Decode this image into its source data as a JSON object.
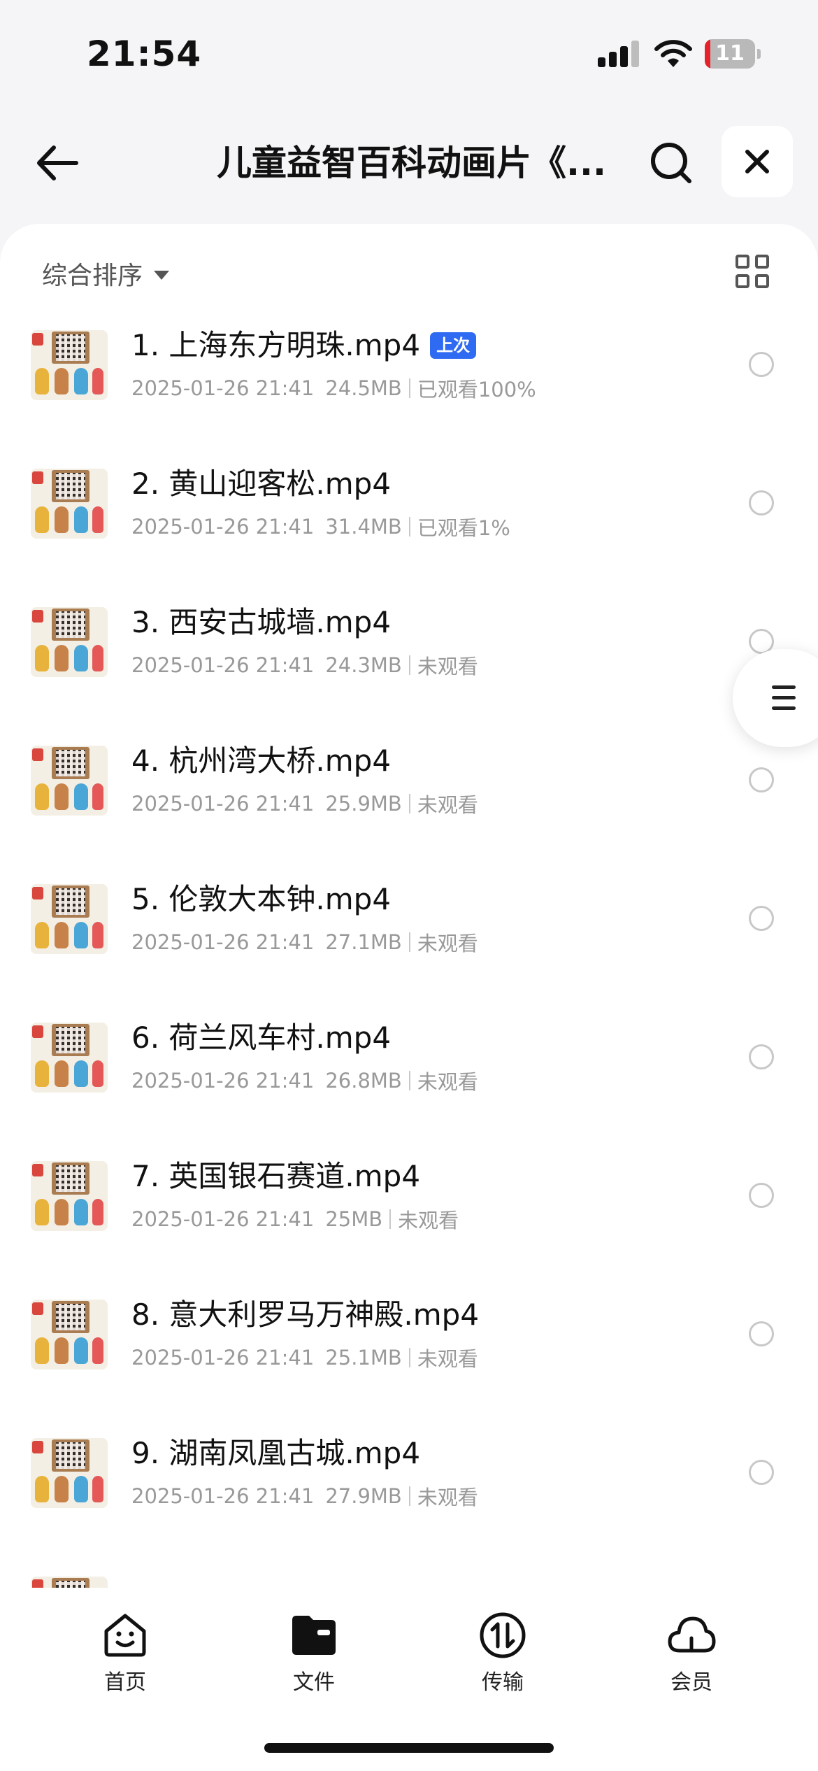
{
  "status_bar": {
    "time": "21:54",
    "battery_level": "11",
    "battery_fraction": 0.11,
    "battery_color": "#e8202a"
  },
  "nav": {
    "back_icon": "arrow-left-icon",
    "title": "儿童益智百科动画片《...",
    "search_icon": "search-icon",
    "close_icon": "close-icon"
  },
  "toolbar": {
    "sort_label": "综合排序",
    "view_toggle_icon": "grid-view-icon"
  },
  "files": [
    {
      "name": "1. 上海东方明珠.mp4",
      "tag": "上次",
      "date": "2025-01-26 21:41",
      "size": "24.5MB",
      "status": "已观看100%"
    },
    {
      "name": "2. 黄山迎客松.mp4",
      "tag": "",
      "date": "2025-01-26 21:41",
      "size": "31.4MB",
      "status": "已观看1%"
    },
    {
      "name": "3. 西安古城墙.mp4",
      "tag": "",
      "date": "2025-01-26 21:41",
      "size": "24.3MB",
      "status": "未观看"
    },
    {
      "name": "4. 杭州湾大桥.mp4",
      "tag": "",
      "date": "2025-01-26 21:41",
      "size": "25.9MB",
      "status": "未观看"
    },
    {
      "name": "5. 伦敦大本钟.mp4",
      "tag": "",
      "date": "2025-01-26 21:41",
      "size": "27.1MB",
      "status": "未观看"
    },
    {
      "name": "6. 荷兰风车村.mp4",
      "tag": "",
      "date": "2025-01-26 21:41",
      "size": "26.8MB",
      "status": "未观看"
    },
    {
      "name": "7. 英国银石赛道.mp4",
      "tag": "",
      "date": "2025-01-26 21:41",
      "size": "25MB",
      "status": "未观看"
    },
    {
      "name": "8. 意大利罗马万神殿.mp4",
      "tag": "",
      "date": "2025-01-26 21:41",
      "size": "25.1MB",
      "status": "未观看"
    },
    {
      "name": "9. 湖南凤凰古城.mp4",
      "tag": "",
      "date": "2025-01-26 21:41",
      "size": "27.9MB",
      "status": "未观看"
    }
  ],
  "tabs": [
    {
      "label": "首页",
      "icon": "home-smile-icon"
    },
    {
      "label": "文件",
      "icon": "folder-icon"
    },
    {
      "label": "传输",
      "icon": "transfer-icon"
    },
    {
      "label": "会员",
      "icon": "cloud-icon"
    }
  ],
  "colors": {
    "accent": "#2f6bf2",
    "meta_text": "#999999"
  }
}
